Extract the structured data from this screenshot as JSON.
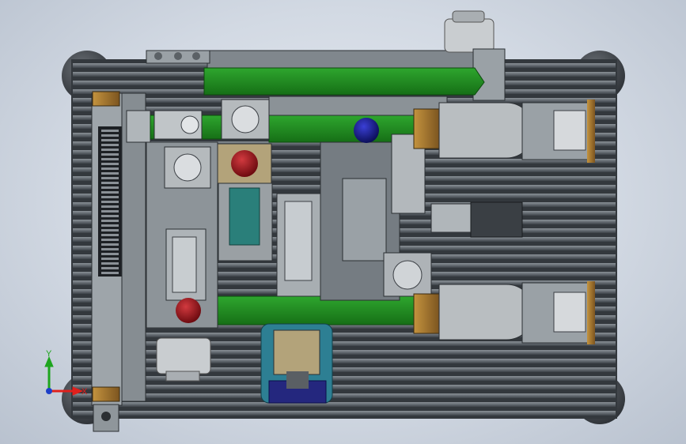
{
  "viewport": {
    "background_color": "#d6dce5"
  },
  "model": {
    "frame_color": "#3c4248",
    "rail_color": "#7d848b",
    "plate_color": "#8c9398",
    "green_color": "#1f8a1f",
    "red_color": "#a1141c",
    "blue_color": "#1a1f8c",
    "bronze_color": "#a5762e",
    "teal_color": "#2a7f7a"
  },
  "triad": {
    "x_label": "X",
    "y_label": "Y",
    "x_color": "#e0201c",
    "y_color": "#1ea51e",
    "z_color": "#1d3fc8"
  }
}
